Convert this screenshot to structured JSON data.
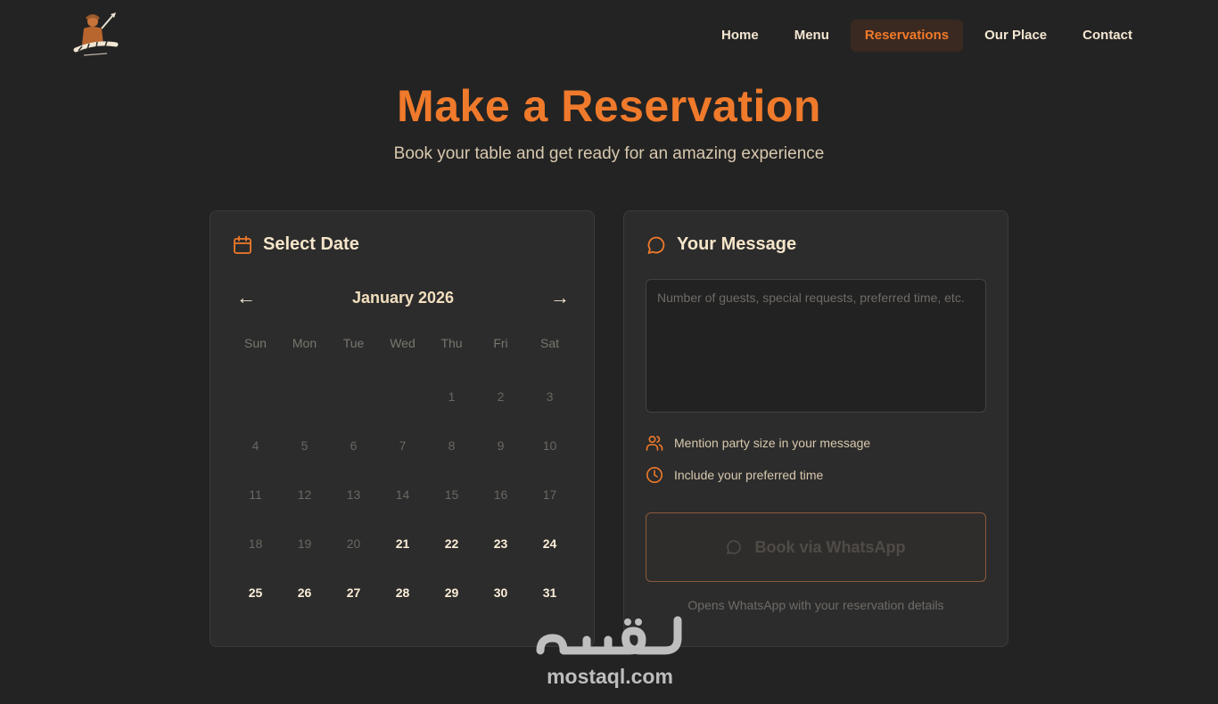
{
  "header": {
    "logo_icon": "chef-logo-icon",
    "nav": [
      {
        "label": "Home"
      },
      {
        "label": "Menu"
      },
      {
        "label": "Reservations"
      },
      {
        "label": "Our Place"
      },
      {
        "label": "Contact"
      }
    ],
    "active_nav": "Reservations"
  },
  "hero": {
    "title": "Make a Reservation",
    "subtitle": "Book your table and get ready for an amazing experience"
  },
  "calendar": {
    "title": "Select Date",
    "title_icon": "calendar-icon",
    "prev_arrow": "←",
    "next_arrow": "→",
    "month": "January 2026",
    "weekdays": [
      "Sun",
      "Mon",
      "Tue",
      "Wed",
      "Thu",
      "Fri",
      "Sat"
    ],
    "leading_blanks": 4,
    "days": [
      {
        "d": "1",
        "state": "past"
      },
      {
        "d": "2",
        "state": "past"
      },
      {
        "d": "3",
        "state": "past"
      },
      {
        "d": "4",
        "state": "past"
      },
      {
        "d": "5",
        "state": "past"
      },
      {
        "d": "6",
        "state": "past"
      },
      {
        "d": "7",
        "state": "past"
      },
      {
        "d": "8",
        "state": "past"
      },
      {
        "d": "9",
        "state": "past"
      },
      {
        "d": "10",
        "state": "past"
      },
      {
        "d": "11",
        "state": "past"
      },
      {
        "d": "12",
        "state": "past"
      },
      {
        "d": "13",
        "state": "past"
      },
      {
        "d": "14",
        "state": "past"
      },
      {
        "d": "15",
        "state": "past"
      },
      {
        "d": "16",
        "state": "past"
      },
      {
        "d": "17",
        "state": "past"
      },
      {
        "d": "18",
        "state": "past"
      },
      {
        "d": "19",
        "state": "past"
      },
      {
        "d": "20",
        "state": "past"
      },
      {
        "d": "21",
        "state": "avail"
      },
      {
        "d": "22",
        "state": "avail"
      },
      {
        "d": "23",
        "state": "avail"
      },
      {
        "d": "24",
        "state": "avail"
      },
      {
        "d": "25",
        "state": "avail"
      },
      {
        "d": "26",
        "state": "avail"
      },
      {
        "d": "27",
        "state": "avail"
      },
      {
        "d": "28",
        "state": "avail"
      },
      {
        "d": "29",
        "state": "avail"
      },
      {
        "d": "30",
        "state": "avail"
      },
      {
        "d": "31",
        "state": "avail"
      }
    ]
  },
  "message": {
    "title": "Your Message",
    "title_icon": "chat-bubble-icon",
    "placeholder": "Number of guests, special requests, preferred time, etc.",
    "value": "",
    "tips": [
      {
        "icon": "users-icon",
        "text": "Mention party size in your message"
      },
      {
        "icon": "clock-icon",
        "text": "Include your preferred time"
      }
    ],
    "button_label": "Book via WhatsApp",
    "button_icon": "whatsapp-icon",
    "note": "Opens WhatsApp with your reservation details"
  },
  "watermark": {
    "arabic": "مستقل",
    "text": "mostaql.com"
  },
  "colors": {
    "background": "#232323",
    "card": "#2c2c2c",
    "accent": "#f07a2b",
    "text": "#f3e3c8"
  }
}
